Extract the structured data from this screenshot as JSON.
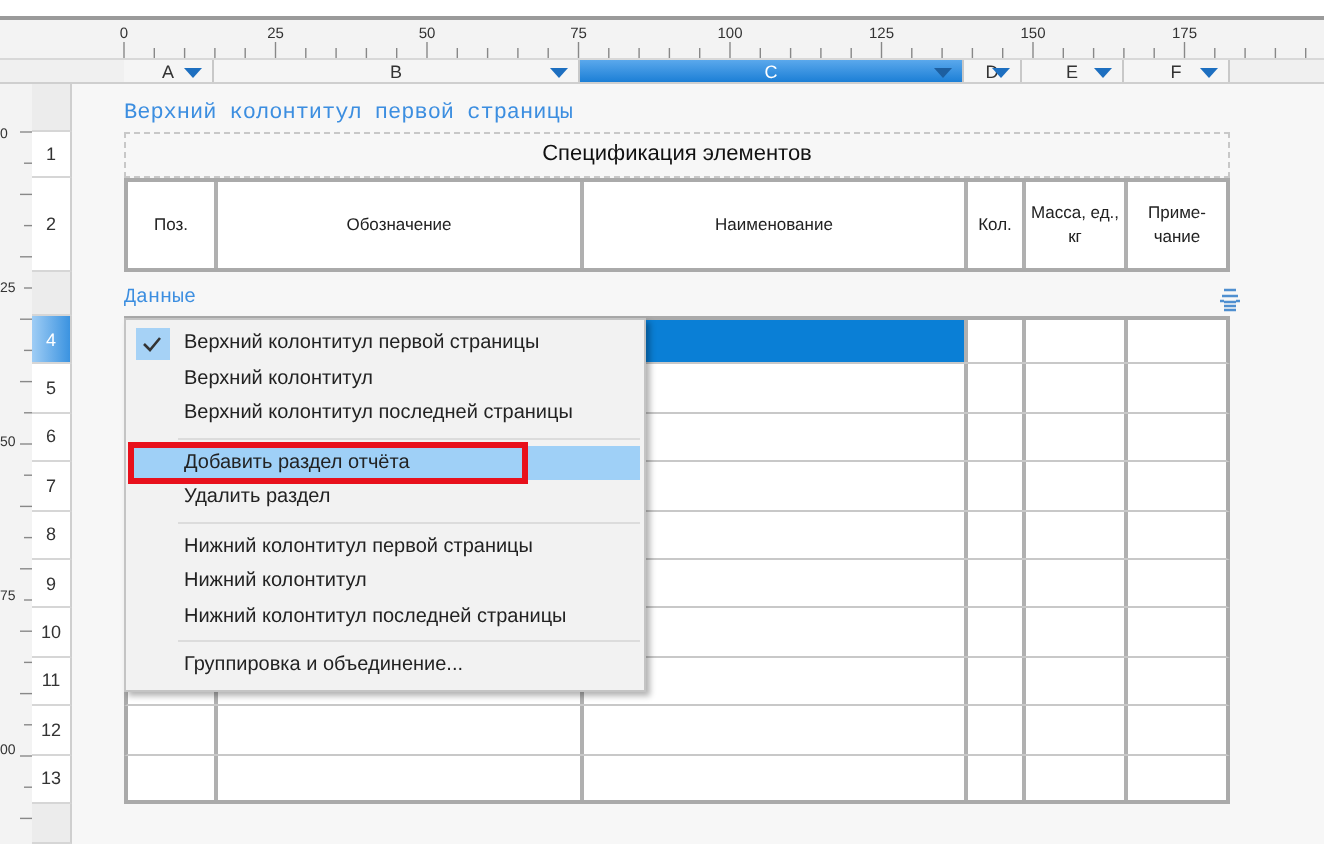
{
  "top_ruler": {
    "labels": [
      "0",
      "25",
      "50",
      "75",
      "100",
      "125",
      "150",
      "175"
    ]
  },
  "left_ruler": {
    "labels": [
      "0",
      "25",
      "50",
      "75",
      "00"
    ]
  },
  "columns": [
    {
      "label": "A",
      "selected": false
    },
    {
      "label": "B",
      "selected": false
    },
    {
      "label": "C",
      "selected": true
    },
    {
      "label": "D",
      "selected": false
    },
    {
      "label": "E",
      "selected": false
    },
    {
      "label": "F",
      "selected": false
    }
  ],
  "page_header": {
    "band_label": "Верхний колонтитул первой страницы",
    "row": "1",
    "title": "Спецификация элементов"
  },
  "table_header": {
    "row": "2",
    "cells": [
      "Поз.",
      "Обозначение",
      "Наименование",
      "Кол.",
      "Масса, ед., кг",
      "Приме- чание"
    ]
  },
  "data_band": {
    "band_label": "Данные",
    "rows": [
      {
        "row": "4",
        "selected": true
      },
      {
        "row": "5",
        "selected": false
      },
      {
        "row": "6",
        "selected": false
      },
      {
        "row": "7",
        "selected": false
      },
      {
        "row": "8",
        "selected": false
      },
      {
        "row": "9",
        "selected": false
      },
      {
        "row": "10",
        "selected": false
      },
      {
        "row": "11",
        "selected": false
      },
      {
        "row": "12",
        "selected": false
      },
      {
        "row": "13",
        "selected": false
      }
    ]
  },
  "context_menu": {
    "items": [
      {
        "kind": "item",
        "label": "Верхний колонтитул первой страницы",
        "checked": true,
        "highlighted": false,
        "outlined": false
      },
      {
        "kind": "item",
        "label": "Верхний колонтитул",
        "checked": false,
        "highlighted": false,
        "outlined": false
      },
      {
        "kind": "item",
        "label": "Верхний колонтитул последней страницы",
        "checked": false,
        "highlighted": false,
        "outlined": false
      },
      {
        "kind": "separator"
      },
      {
        "kind": "item",
        "label": "Добавить раздел отчёта",
        "checked": false,
        "highlighted": true,
        "outlined": true
      },
      {
        "kind": "item",
        "label": "Удалить раздел",
        "checked": false,
        "highlighted": false,
        "outlined": false
      },
      {
        "kind": "separator"
      },
      {
        "kind": "item",
        "label": "Нижний колонтитул первой страницы",
        "checked": false,
        "highlighted": false,
        "outlined": false
      },
      {
        "kind": "item",
        "label": "Нижний колонтитул",
        "checked": false,
        "highlighted": false,
        "outlined": false
      },
      {
        "kind": "item",
        "label": "Нижний колонтитул последней страницы",
        "checked": false,
        "highlighted": false,
        "outlined": false
      },
      {
        "kind": "separator"
      },
      {
        "kind": "item",
        "label": "Группировка и объединение...",
        "checked": false,
        "highlighted": false,
        "outlined": false
      }
    ]
  }
}
